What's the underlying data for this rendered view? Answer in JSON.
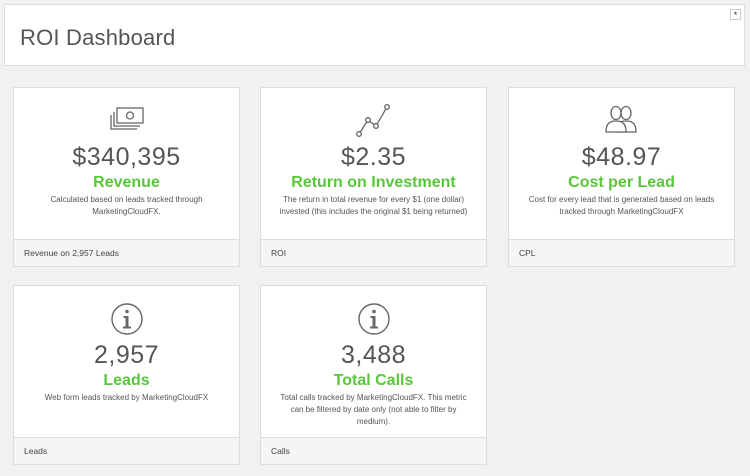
{
  "header": {
    "title": "ROI Dashboard",
    "corner_glyph": "*"
  },
  "cards": [
    {
      "icon": "money-icon",
      "value": "$340,395",
      "label": "Revenue",
      "desc": "Calculated based on leads tracked through MarketingCloudFX.",
      "footer": "Revenue on 2,957 Leads"
    },
    {
      "icon": "line-chart-icon",
      "value": "$2.35",
      "label": "Return on Investment",
      "desc": "The return in total revenue for every $1 (one dollar) invested (this includes the original $1 being returned)",
      "footer": "ROI"
    },
    {
      "icon": "users-icon",
      "value": "$48.97",
      "label": "Cost per Lead",
      "desc": "Cost for every lead that is generated based on leads tracked through MarketingCloudFX",
      "footer": "CPL"
    },
    {
      "icon": "info-icon",
      "value": "2,957",
      "label": "Leads",
      "desc": "Web form leads tracked by MarketingCloudFX",
      "footer": "Leads"
    },
    {
      "icon": "info-icon",
      "value": "3,488",
      "label": "Total Calls",
      "desc": "Total calls tracked by MarketingCloudFX. This metric can be filtered by date only (not able to filter by medium).",
      "footer": "Calls"
    }
  ],
  "colors": {
    "accent_green": "#5ac63b",
    "icon_gray": "#666666"
  }
}
